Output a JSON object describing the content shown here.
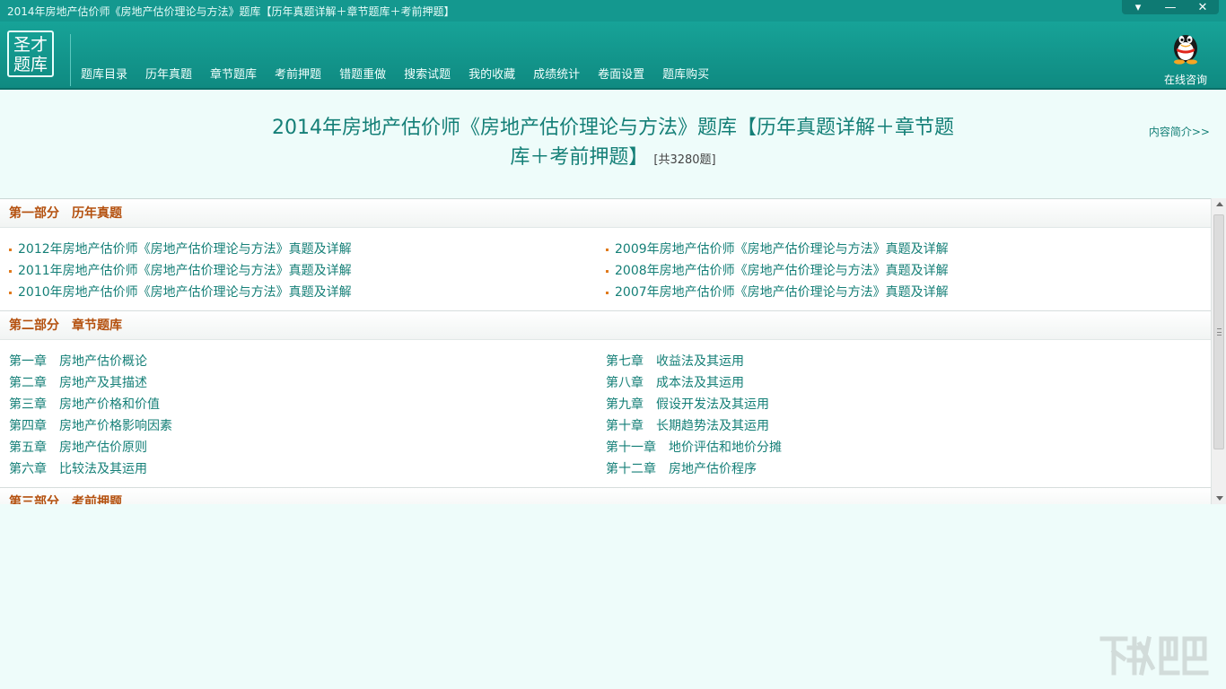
{
  "window": {
    "title": "2014年房地产估价师《房地产估价理论与方法》题库【历年真题详解＋章节题库＋考前押题】",
    "controls": {
      "menu": "▾",
      "minimize": "—",
      "close": "✕"
    }
  },
  "logo": {
    "line1": "圣才",
    "line2": "题库"
  },
  "nav": [
    "题库目录",
    "历年真题",
    "章节题库",
    "考前押题",
    "错题重做",
    "搜索试题",
    "我的收藏",
    "成绩统计",
    "卷面设置",
    "题库购买"
  ],
  "consult": {
    "label": "在线咨询",
    "icon": "qq-penguin-icon"
  },
  "heading": {
    "line1": "2014年房地产估价师《房地产估价理论与方法》题库【历年真题详解＋章节题",
    "line2": "库＋考前押题】",
    "count": "[共3280题]"
  },
  "intro_link": "内容简介>>",
  "sections": {
    "past": {
      "part": "第一部分",
      "name": "历年真题",
      "left": [
        "2012年房地产估价师《房地产估价理论与方法》真题及详解",
        "2011年房地产估价师《房地产估价理论与方法》真题及详解",
        "2010年房地产估价师《房地产估价理论与方法》真题及详解"
      ],
      "right": [
        "2009年房地产估价师《房地产估价理论与方法》真题及详解",
        "2008年房地产估价师《房地产估价理论与方法》真题及详解",
        "2007年房地产估价师《房地产估价理论与方法》真题及详解"
      ]
    },
    "chapters": {
      "part": "第二部分",
      "name": "章节题库",
      "left": [
        {
          "num": "第一章",
          "title": "房地产估价概论"
        },
        {
          "num": "第二章",
          "title": "房地产及其描述"
        },
        {
          "num": "第三章",
          "title": "房地产价格和价值"
        },
        {
          "num": "第四章",
          "title": "房地产价格影响因素"
        },
        {
          "num": "第五章",
          "title": "房地产估价原则"
        },
        {
          "num": "第六章",
          "title": "比较法及其运用"
        }
      ],
      "right": [
        {
          "num": "第七章",
          "title": "收益法及其运用"
        },
        {
          "num": "第八章",
          "title": "成本法及其运用"
        },
        {
          "num": "第九章",
          "title": "假设开发法及其运用"
        },
        {
          "num": "第十章",
          "title": "长期趋势法及其运用"
        },
        {
          "num": "第十一章",
          "title": "地价评估和地价分摊"
        },
        {
          "num": "第十二章",
          "title": "房地产估价程序"
        }
      ]
    },
    "exam": {
      "part": "第三部分",
      "name": "考前押题"
    }
  },
  "colors": {
    "titlebar": "#14988f",
    "header": "#17a398",
    "accent_text": "#147f77",
    "section_title": "#b4500e",
    "bullet": "#e07a1d",
    "background": "#eefcfa"
  }
}
